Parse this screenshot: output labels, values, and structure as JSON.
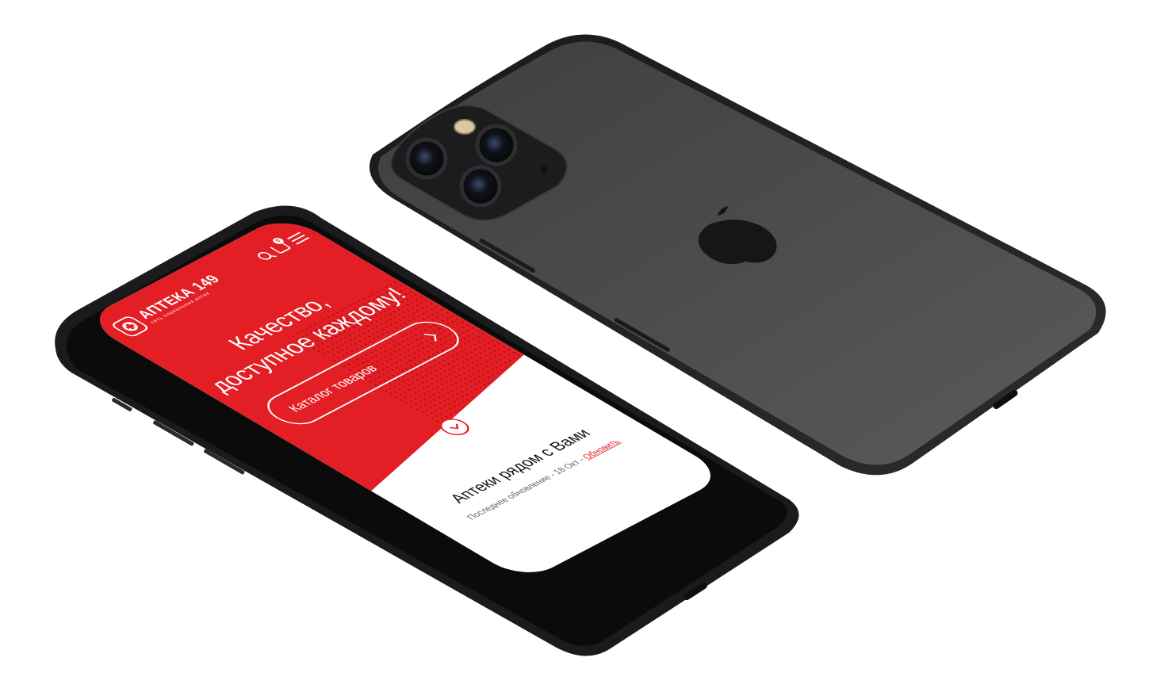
{
  "header": {
    "logo_title": "АПТЕКА 149",
    "logo_subtitle": "сеть социальных аптек",
    "cart_count": "0"
  },
  "hero": {
    "title_line1": "Качество,",
    "title_line2": "доступное каждому!",
    "catalog_button_label": "Каталог товаров"
  },
  "nearby": {
    "title": "Аптеки рядом с Вами",
    "update_prefix": "Последнее обновление - 18 Окт - ",
    "update_link_label": "Обновить"
  },
  "icons": {
    "header": [
      "search-icon",
      "cart-icon",
      "menu-icon"
    ],
    "logo": "pharmacy-cross-icon",
    "scroll": "chevron-down-icon",
    "catalog": "chevron-right-icon"
  },
  "colors": {
    "brand_red": "#e31e24",
    "phone_body": "#2b2b2d",
    "back_glass": "#4a4a4c"
  }
}
